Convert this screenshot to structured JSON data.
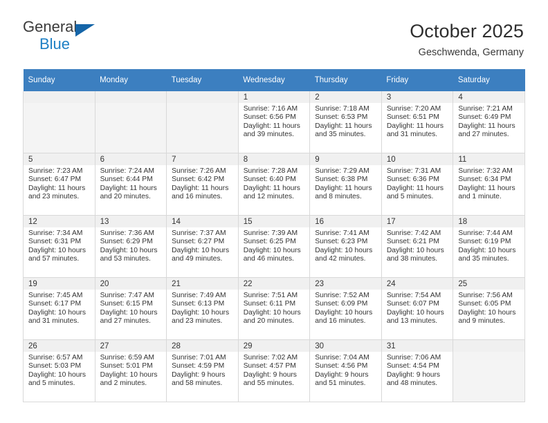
{
  "brand": {
    "name_top": "General",
    "name_bottom": "Blue",
    "triangle_color": "#1565a8",
    "blue_color": "#1d7fc4"
  },
  "header": {
    "title": "October 2025",
    "subtitle": "Geschwenda, Germany",
    "header_bg": "#3c7fc0"
  },
  "weekday_headers": [
    "Sunday",
    "Monday",
    "Tuesday",
    "Wednesday",
    "Thursday",
    "Friday",
    "Saturday"
  ],
  "labels": {
    "sunrise_prefix": "Sunrise:",
    "sunset_prefix": "Sunset:",
    "daylight_prefix": "Daylight:"
  },
  "weeks": [
    [
      {
        "empty": true
      },
      {
        "empty": true
      },
      {
        "empty": true
      },
      {
        "day": "1",
        "sunrise": "Sunrise: 7:16 AM",
        "sunset": "Sunset: 6:56 PM",
        "daylight_1": "Daylight: 11 hours",
        "daylight_2": "and 39 minutes."
      },
      {
        "day": "2",
        "sunrise": "Sunrise: 7:18 AM",
        "sunset": "Sunset: 6:53 PM",
        "daylight_1": "Daylight: 11 hours",
        "daylight_2": "and 35 minutes."
      },
      {
        "day": "3",
        "sunrise": "Sunrise: 7:20 AM",
        "sunset": "Sunset: 6:51 PM",
        "daylight_1": "Daylight: 11 hours",
        "daylight_2": "and 31 minutes."
      },
      {
        "day": "4",
        "sunrise": "Sunrise: 7:21 AM",
        "sunset": "Sunset: 6:49 PM",
        "daylight_1": "Daylight: 11 hours",
        "daylight_2": "and 27 minutes."
      }
    ],
    [
      {
        "day": "5",
        "sunrise": "Sunrise: 7:23 AM",
        "sunset": "Sunset: 6:47 PM",
        "daylight_1": "Daylight: 11 hours",
        "daylight_2": "and 23 minutes."
      },
      {
        "day": "6",
        "sunrise": "Sunrise: 7:24 AM",
        "sunset": "Sunset: 6:44 PM",
        "daylight_1": "Daylight: 11 hours",
        "daylight_2": "and 20 minutes."
      },
      {
        "day": "7",
        "sunrise": "Sunrise: 7:26 AM",
        "sunset": "Sunset: 6:42 PM",
        "daylight_1": "Daylight: 11 hours",
        "daylight_2": "and 16 minutes."
      },
      {
        "day": "8",
        "sunrise": "Sunrise: 7:28 AM",
        "sunset": "Sunset: 6:40 PM",
        "daylight_1": "Daylight: 11 hours",
        "daylight_2": "and 12 minutes."
      },
      {
        "day": "9",
        "sunrise": "Sunrise: 7:29 AM",
        "sunset": "Sunset: 6:38 PM",
        "daylight_1": "Daylight: 11 hours",
        "daylight_2": "and 8 minutes."
      },
      {
        "day": "10",
        "sunrise": "Sunrise: 7:31 AM",
        "sunset": "Sunset: 6:36 PM",
        "daylight_1": "Daylight: 11 hours",
        "daylight_2": "and 5 minutes."
      },
      {
        "day": "11",
        "sunrise": "Sunrise: 7:32 AM",
        "sunset": "Sunset: 6:34 PM",
        "daylight_1": "Daylight: 11 hours",
        "daylight_2": "and 1 minute."
      }
    ],
    [
      {
        "day": "12",
        "sunrise": "Sunrise: 7:34 AM",
        "sunset": "Sunset: 6:31 PM",
        "daylight_1": "Daylight: 10 hours",
        "daylight_2": "and 57 minutes."
      },
      {
        "day": "13",
        "sunrise": "Sunrise: 7:36 AM",
        "sunset": "Sunset: 6:29 PM",
        "daylight_1": "Daylight: 10 hours",
        "daylight_2": "and 53 minutes."
      },
      {
        "day": "14",
        "sunrise": "Sunrise: 7:37 AM",
        "sunset": "Sunset: 6:27 PM",
        "daylight_1": "Daylight: 10 hours",
        "daylight_2": "and 49 minutes."
      },
      {
        "day": "15",
        "sunrise": "Sunrise: 7:39 AM",
        "sunset": "Sunset: 6:25 PM",
        "daylight_1": "Daylight: 10 hours",
        "daylight_2": "and 46 minutes."
      },
      {
        "day": "16",
        "sunrise": "Sunrise: 7:41 AM",
        "sunset": "Sunset: 6:23 PM",
        "daylight_1": "Daylight: 10 hours",
        "daylight_2": "and 42 minutes."
      },
      {
        "day": "17",
        "sunrise": "Sunrise: 7:42 AM",
        "sunset": "Sunset: 6:21 PM",
        "daylight_1": "Daylight: 10 hours",
        "daylight_2": "and 38 minutes."
      },
      {
        "day": "18",
        "sunrise": "Sunrise: 7:44 AM",
        "sunset": "Sunset: 6:19 PM",
        "daylight_1": "Daylight: 10 hours",
        "daylight_2": "and 35 minutes."
      }
    ],
    [
      {
        "day": "19",
        "sunrise": "Sunrise: 7:45 AM",
        "sunset": "Sunset: 6:17 PM",
        "daylight_1": "Daylight: 10 hours",
        "daylight_2": "and 31 minutes."
      },
      {
        "day": "20",
        "sunrise": "Sunrise: 7:47 AM",
        "sunset": "Sunset: 6:15 PM",
        "daylight_1": "Daylight: 10 hours",
        "daylight_2": "and 27 minutes."
      },
      {
        "day": "21",
        "sunrise": "Sunrise: 7:49 AM",
        "sunset": "Sunset: 6:13 PM",
        "daylight_1": "Daylight: 10 hours",
        "daylight_2": "and 23 minutes."
      },
      {
        "day": "22",
        "sunrise": "Sunrise: 7:51 AM",
        "sunset": "Sunset: 6:11 PM",
        "daylight_1": "Daylight: 10 hours",
        "daylight_2": "and 20 minutes."
      },
      {
        "day": "23",
        "sunrise": "Sunrise: 7:52 AM",
        "sunset": "Sunset: 6:09 PM",
        "daylight_1": "Daylight: 10 hours",
        "daylight_2": "and 16 minutes."
      },
      {
        "day": "24",
        "sunrise": "Sunrise: 7:54 AM",
        "sunset": "Sunset: 6:07 PM",
        "daylight_1": "Daylight: 10 hours",
        "daylight_2": "and 13 minutes."
      },
      {
        "day": "25",
        "sunrise": "Sunrise: 7:56 AM",
        "sunset": "Sunset: 6:05 PM",
        "daylight_1": "Daylight: 10 hours",
        "daylight_2": "and 9 minutes."
      }
    ],
    [
      {
        "day": "26",
        "sunrise": "Sunrise: 6:57 AM",
        "sunset": "Sunset: 5:03 PM",
        "daylight_1": "Daylight: 10 hours",
        "daylight_2": "and 5 minutes."
      },
      {
        "day": "27",
        "sunrise": "Sunrise: 6:59 AM",
        "sunset": "Sunset: 5:01 PM",
        "daylight_1": "Daylight: 10 hours",
        "daylight_2": "and 2 minutes."
      },
      {
        "day": "28",
        "sunrise": "Sunrise: 7:01 AM",
        "sunset": "Sunset: 4:59 PM",
        "daylight_1": "Daylight: 9 hours",
        "daylight_2": "and 58 minutes."
      },
      {
        "day": "29",
        "sunrise": "Sunrise: 7:02 AM",
        "sunset": "Sunset: 4:57 PM",
        "daylight_1": "Daylight: 9 hours",
        "daylight_2": "and 55 minutes."
      },
      {
        "day": "30",
        "sunrise": "Sunrise: 7:04 AM",
        "sunset": "Sunset: 4:56 PM",
        "daylight_1": "Daylight: 9 hours",
        "daylight_2": "and 51 minutes."
      },
      {
        "day": "31",
        "sunrise": "Sunrise: 7:06 AM",
        "sunset": "Sunset: 4:54 PM",
        "daylight_1": "Daylight: 9 hours",
        "daylight_2": "and 48 minutes."
      },
      {
        "empty": true
      }
    ]
  ]
}
